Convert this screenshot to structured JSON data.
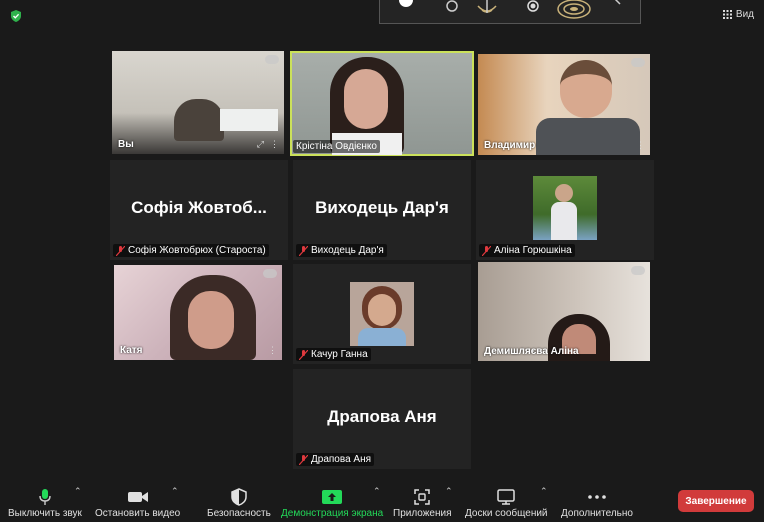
{
  "top": {
    "view_label": "Вид"
  },
  "tiles": {
    "self": {
      "name": "Вы"
    },
    "kristina": {
      "name": "Крістіна Овдієнко"
    },
    "volodymyr": {
      "name": "Владимир"
    },
    "sofia": {
      "big": "Софія Жовтоб...",
      "name": "Софія Жовтобрюх (Староста)"
    },
    "vyhodets": {
      "big": "Виходець Дар'я",
      "name": "Виходець Дар'я"
    },
    "alina_g": {
      "name": "Аліна Горюшкіна"
    },
    "katya": {
      "name": "Катя"
    },
    "kachur": {
      "name": "Качур Ганна"
    },
    "demyshl": {
      "name": "Демишляєва Аліна"
    },
    "drapova": {
      "big": "Драпова Аня",
      "name": "Драпова Аня"
    }
  },
  "toolbar": {
    "mute": "Выключить звук",
    "video": "Остановить видео",
    "security": "Безопасность",
    "share": "Демонстрация экрана",
    "apps": "Приложения",
    "whiteboard": "Доски сообщений",
    "more": "Дополнительно",
    "end": "Завершение"
  },
  "colors": {
    "active_speaker": "#cbe15a",
    "share_green": "#23d959",
    "end_red": "#d13b3b",
    "mic_off_red": "#e0393e"
  }
}
